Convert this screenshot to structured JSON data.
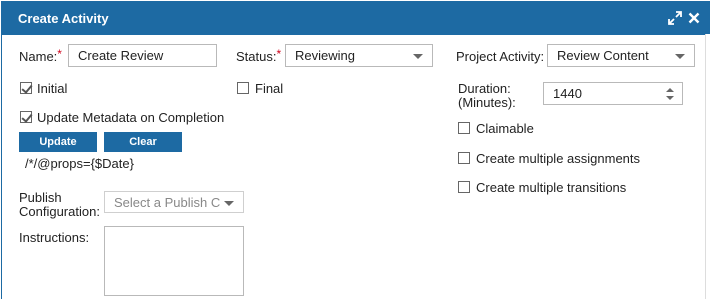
{
  "dialog": {
    "title": "Create Activity",
    "icons": {
      "maximize": "expand-arrows-icon",
      "close": "close-x-icon"
    }
  },
  "colors": {
    "titlebar": "#1d6aa3",
    "required": "#d0021b",
    "button": "#1d6aa3"
  },
  "form": {
    "name": {
      "label": "Name:",
      "required_mark": "*",
      "value": "Create Review"
    },
    "status": {
      "label": "Status:",
      "required_mark": "*",
      "value": "Reviewing"
    },
    "project_activity": {
      "label": "Project Activity:",
      "value": "Review Content"
    },
    "initial": {
      "label": "Initial",
      "checked": true
    },
    "final": {
      "label": "Final",
      "checked": false
    },
    "update_metadata": {
      "label": "Update Metadata on Completion",
      "checked": true
    },
    "buttons": {
      "update": "Update",
      "clear": "Clear"
    },
    "metadata_expression": "/*/@props={$Date}",
    "duration": {
      "label_line1": "Duration:",
      "label_line2": "(Minutes):",
      "value": "1440"
    },
    "claimable": {
      "label": "Claimable",
      "checked": false
    },
    "multiple_assignments": {
      "label": "Create multiple assignments",
      "checked": false
    },
    "multiple_transitions": {
      "label": "Create multiple transitions",
      "checked": false
    },
    "publish_configuration": {
      "label_line1": "Publish",
      "label_line2": "Configuration:",
      "placeholder": "Select a Publish C"
    },
    "instructions": {
      "label": "Instructions:",
      "value": ""
    }
  }
}
